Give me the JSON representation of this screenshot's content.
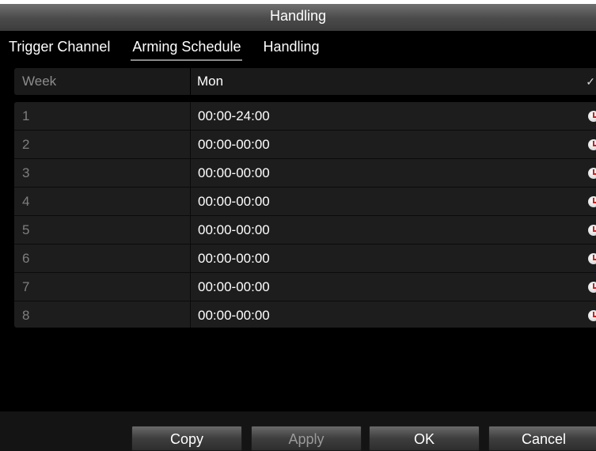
{
  "dialog": {
    "title": "Handling",
    "tabs": [
      {
        "label": "Trigger Channel",
        "active": false
      },
      {
        "label": "Arming Schedule",
        "active": true
      },
      {
        "label": "Handling",
        "active": false
      }
    ],
    "week": {
      "label": "Week",
      "value": "Mon"
    },
    "schedule": [
      {
        "num": "1",
        "time": "00:00-24:00"
      },
      {
        "num": "2",
        "time": "00:00-00:00"
      },
      {
        "num": "3",
        "time": "00:00-00:00"
      },
      {
        "num": "4",
        "time": "00:00-00:00"
      },
      {
        "num": "5",
        "time": "00:00-00:00"
      },
      {
        "num": "6",
        "time": "00:00-00:00"
      },
      {
        "num": "7",
        "time": "00:00-00:00"
      },
      {
        "num": "8",
        "time": "00:00-00:00"
      }
    ],
    "buttons": {
      "copy": "Copy",
      "apply": "Apply",
      "ok": "OK",
      "cancel": "Cancel"
    }
  },
  "icons": {
    "clock": "clock-icon",
    "dropdown": "chevron-down-icon"
  },
  "colors": {
    "background": "#000000",
    "title_bar": "#4a4a4a",
    "clock_hand": "#d12020"
  }
}
